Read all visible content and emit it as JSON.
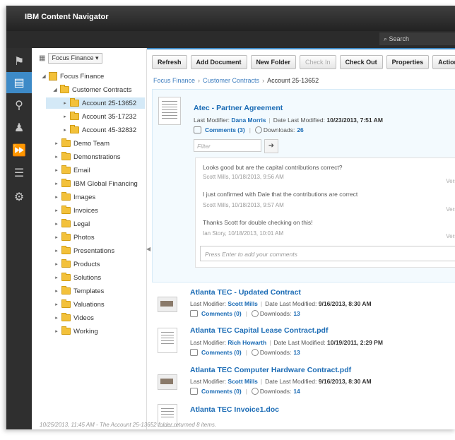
{
  "app": {
    "title": "IBM Content Navigator",
    "search_placeholder": "Search"
  },
  "rail": [
    "favorites-icon",
    "browse-icon",
    "search-icon",
    "teamspaces-icon",
    "work-icon",
    "reports-icon",
    "settings-icon"
  ],
  "tree": {
    "repository": "Focus Finance",
    "root": "Focus Finance",
    "customer_contracts": "Customer Contracts",
    "accounts": [
      "Account 25-13652",
      "Account 35-17232",
      "Account 45-32832"
    ],
    "folders": [
      "Demo Team",
      "Demonstrations",
      "Email",
      "IBM Global Financing",
      "Images",
      "Invoices",
      "Legal",
      "Photos",
      "Presentations",
      "Products",
      "Solutions",
      "Templates",
      "Valuations",
      "Videos",
      "Working"
    ]
  },
  "toolbar": {
    "refresh": "Refresh",
    "add_document": "Add Document",
    "new_folder": "New Folder",
    "check_in": "Check In",
    "check_out": "Check Out",
    "properties": "Properties",
    "actions": "Actions"
  },
  "breadcrumb": {
    "b1": "Focus Finance",
    "b2": "Customer Contracts",
    "b3": "Account 25-13652"
  },
  "labels": {
    "last_modifier": "Last Modifier:",
    "date_last_modified": "Date Last Modified:",
    "downloads": "Downloads:"
  },
  "docs": [
    {
      "name": "Atec - Partner Agreement",
      "modifier": "Dana Morris",
      "date": "10/23/2013, 7:51 AM",
      "comments": "Comments (3)",
      "downloads": "26"
    },
    {
      "name": "Atlanta TEC - Updated Contract",
      "modifier": "Scott Mills",
      "date": "9/16/2013, 8:30 AM",
      "comments": "Comments (0)",
      "downloads": "13"
    },
    {
      "name": "Atlanta TEC Capital Lease Contract.pdf",
      "modifier": "Rich Howarth",
      "date": "10/19/2011, 2:29 PM",
      "comments": "Comments (0)",
      "downloads": "13"
    },
    {
      "name": "Atlanta TEC Computer Hardware Contract.pdf",
      "modifier": "Scott Mills",
      "date": "9/16/2013, 8:30 AM",
      "comments": "Comments (0)",
      "downloads": "14"
    },
    {
      "name": "Atlanta TEC Invoice1.doc"
    }
  ],
  "comments": {
    "filter_placeholder": "Filter",
    "items": [
      {
        "text": "Looks good but are the capital contributions correct?",
        "by": "Scott Mills, 10/18/2013, 9:56 AM",
        "version": "Versi"
      },
      {
        "text": "I just confirmed with Dale that the contributions are correct",
        "by": "Scott Mills, 10/18/2013, 9:57 AM",
        "version": "Versi"
      },
      {
        "text": "Thanks Scott for double checking on this!",
        "by": "Ian Story, 10/18/2013, 10:01 AM",
        "version": "Versi"
      }
    ],
    "input_placeholder": "Press Enter to add your comments"
  },
  "status": "10/25/2013, 11:45 AM - The Account 25-13652 folder returned 8 items."
}
